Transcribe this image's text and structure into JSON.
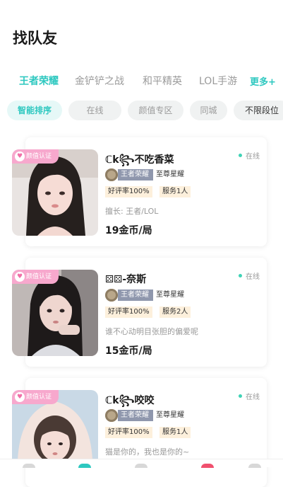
{
  "page": {
    "title": "找队友"
  },
  "game_tabs": [
    "王者荣耀",
    "金铲铲之战",
    "和平精英",
    "LOL手游"
  ],
  "more_label": "更多+",
  "filters": [
    "智能排序",
    "在线",
    "颜值专区",
    "同城",
    "不限段位"
  ],
  "badge_label": "颜值认证",
  "cards": [
    {
      "name": "ℂk꧂不吃香菜",
      "status": "在线",
      "game": "王者荣耀",
      "tier": "至尊星耀",
      "rating": "好评率100%",
      "served": "服务1人",
      "desc": "擅长: 王者/LOL",
      "price": "19金币/局"
    },
    {
      "name": "⚄⚄-奈斯",
      "status": "在线",
      "game": "王者荣耀",
      "tier": "至尊星耀",
      "rating": "好评率100%",
      "served": "服务2人",
      "desc": "谁不心动明目张胆的偏爱呢",
      "price": "15金币/局"
    },
    {
      "name": "ℂk꧂咬咬",
      "status": "在线",
      "game": "王者荣耀",
      "tier": "至尊星耀",
      "rating": "好评率100%",
      "served": "服务1人",
      "desc": "猫是你的，我也是你的~",
      "price": ""
    }
  ],
  "colors": {
    "accent": "#2ec8c0",
    "badge": "#f7a8cd",
    "online_dot": "#3fd3b6",
    "tag_bg": "#fdf0dc"
  },
  "nav_icons": [
    "home-icon",
    "team-icon",
    "discover-icon",
    "message-icon",
    "profile-icon"
  ]
}
